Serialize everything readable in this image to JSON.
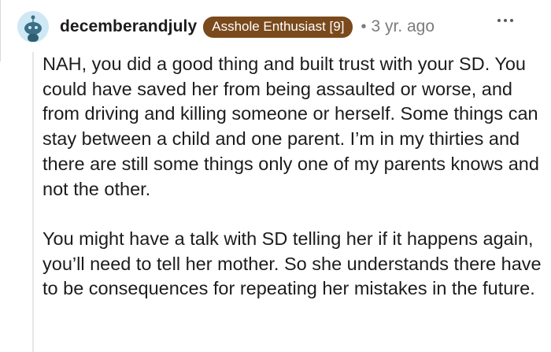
{
  "comment": {
    "username": "decemberandjuly",
    "flair": "Asshole Enthusiast [9]",
    "separator": "•",
    "age": "3 yr. ago",
    "paragraphs": [
      "NAH, you did a good thing and built trust with your SD. You could have saved her from being assaulted or worse, and from driving and killing someone or herself. Some things can stay between a child and one parent. I’m in my thirties and there are still some things only one of my parents knows and not the other.",
      "You might have a talk with SD telling her if it happens again, you’ll need to tell her mother. So she understands there have to be consequences for repeating her mistakes in the future."
    ]
  },
  "icons": {
    "avatar": "snoo-avatar-icon",
    "more": "more-options-icon"
  },
  "colors": {
    "flair_background": "#7a4a1c",
    "avatar_background": "#cfe8f5",
    "meta_text": "#7c7c7c"
  }
}
